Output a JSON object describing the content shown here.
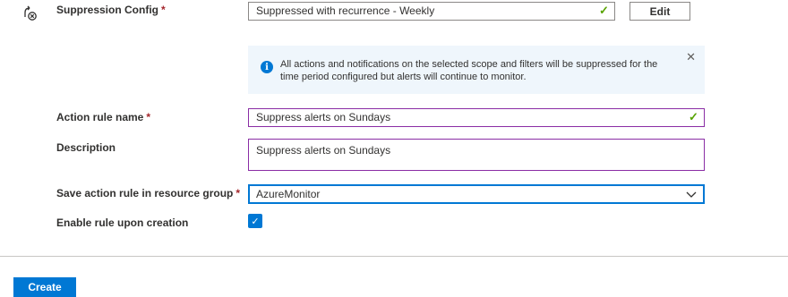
{
  "suppression": {
    "label": "Suppression Config",
    "required_mark": "*",
    "value": "Suppressed with recurrence - Weekly",
    "edit_label": "Edit",
    "icon": "alert-off-icon"
  },
  "info_banner": {
    "text": "All actions and notifications on the selected scope and filters will be suppressed for the time period configured but alerts will continue to monitor.",
    "icon": "info-icon",
    "close_icon": "close-icon"
  },
  "action_rule_name": {
    "label": "Action rule name",
    "required_mark": "*",
    "value": "Suppress alerts on Sundays"
  },
  "description": {
    "label": "Description",
    "value": "Suppress alerts on Sundays"
  },
  "resource_group": {
    "label": "Save action rule in resource group",
    "required_mark": "*",
    "value": "AzureMonitor"
  },
  "enable_rule": {
    "label": "Enable rule upon creation",
    "checked": true
  },
  "footer": {
    "create_label": "Create"
  },
  "colors": {
    "accent": "#0078d4",
    "valid_check": "#57a300",
    "field_border_active": "#8a2da5",
    "required": "#a4262c",
    "info_background": "#eff6fc"
  }
}
